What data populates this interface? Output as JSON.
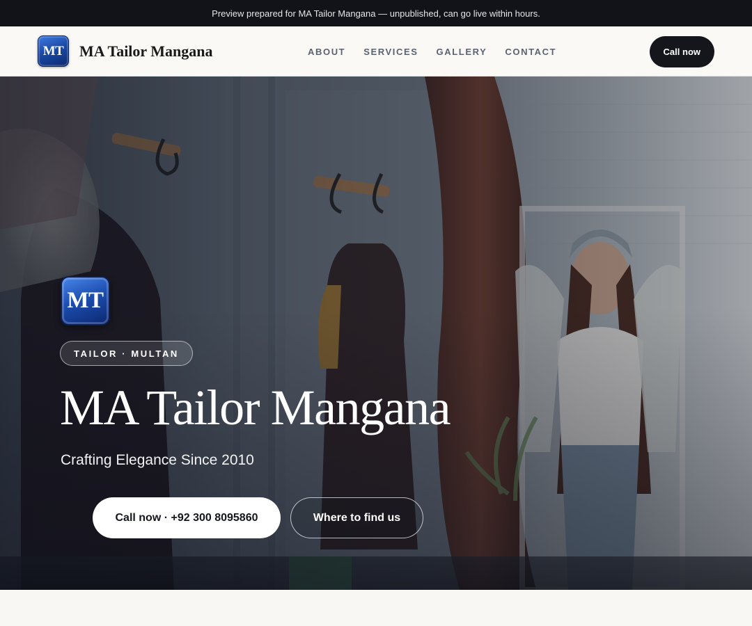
{
  "announcement": "Preview prepared for MA Tailor Mangana — unpublished, can go live within hours.",
  "brand": {
    "logo_text": "MT",
    "name": "MA Tailor Mangana"
  },
  "nav": {
    "links": [
      "ABOUT",
      "SERVICES",
      "GALLERY",
      "CONTACT"
    ],
    "cta": "Call now"
  },
  "hero": {
    "logo_text": "MT",
    "tag": "TAILOR · MULTAN",
    "title": "MA Tailor Mangana",
    "subtitle": "Crafting Elegance Since 2010",
    "primary_button": "Call now · +92 300 8095860",
    "secondary_button": "Where to find us",
    "image": "fitting-room-photo"
  },
  "colors": {
    "dark": "#111318",
    "logo_blue": "#1c4ba8",
    "nav_link": "#5b6270",
    "page_bg": "#f8f7f4"
  }
}
